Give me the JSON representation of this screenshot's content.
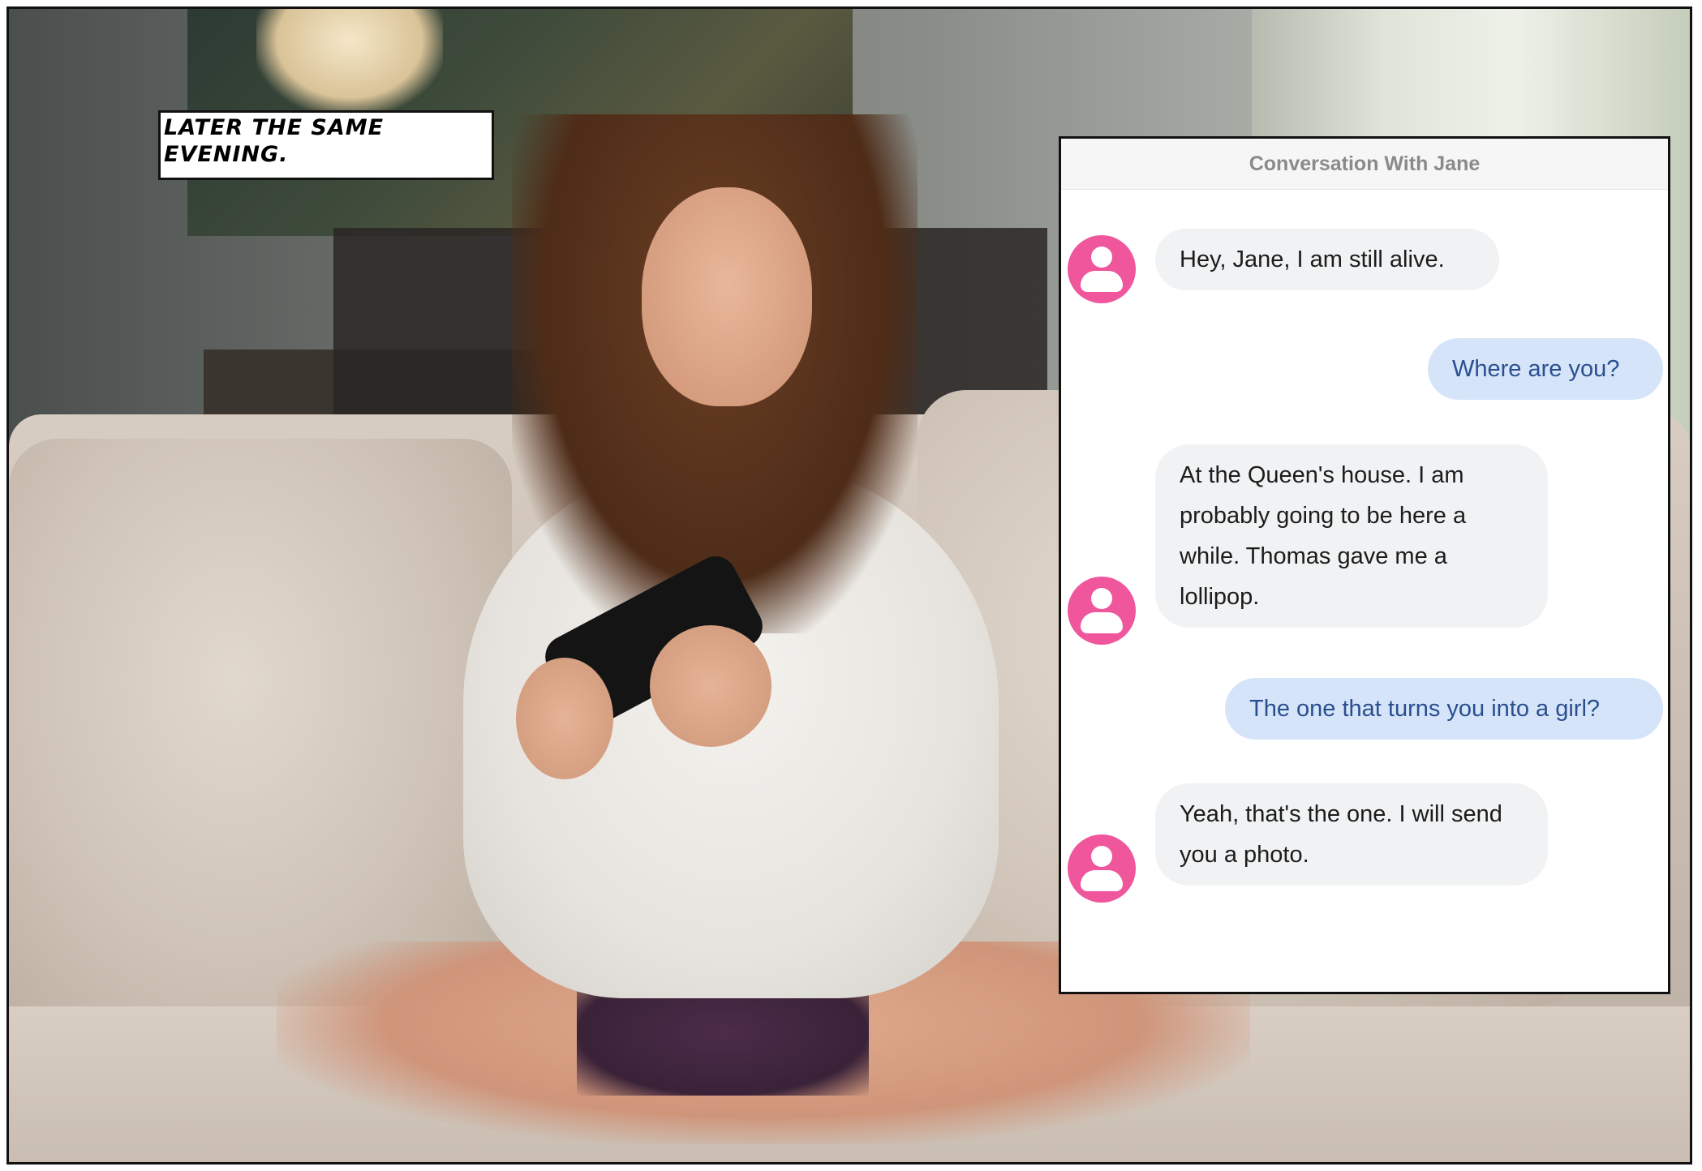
{
  "caption": {
    "text": "Later the same evening."
  },
  "chat": {
    "title": "Conversation With Jane",
    "accent_color": "#f0569c",
    "incoming_bubble_color": "#f1f2f3",
    "outgoing_bubble_color": "#d5e4f8",
    "messages": [
      {
        "direction": "incoming",
        "text": "Hey, Jane, I am still alive.",
        "avatar_icon": "user-avatar-icon"
      },
      {
        "direction": "outgoing",
        "text": "Where are you?"
      },
      {
        "direction": "incoming",
        "text": "At the Queen's house. I am probably going to be here a while. Thomas gave me a lollipop.",
        "avatar_icon": "user-avatar-icon"
      },
      {
        "direction": "outgoing",
        "text": "The one that turns you into a girl?"
      },
      {
        "direction": "incoming",
        "text": "Yeah, that's the one. I will send you a photo.",
        "avatar_icon": "user-avatar-icon"
      }
    ]
  }
}
